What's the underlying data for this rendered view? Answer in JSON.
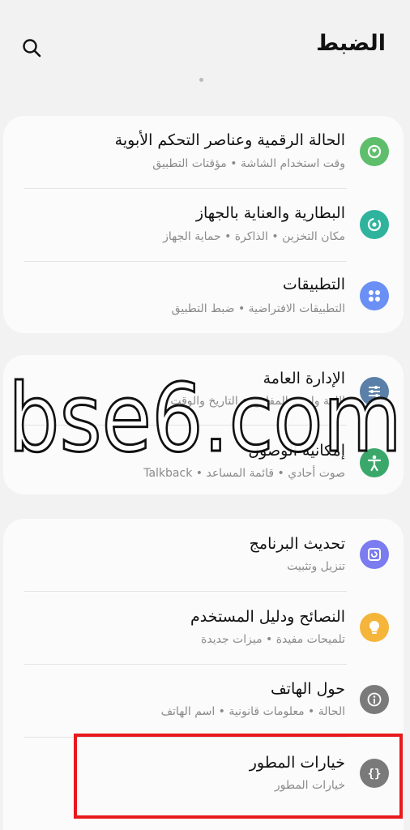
{
  "header": {
    "title": "الضبط",
    "search_icon": "search-icon"
  },
  "groups": [
    {
      "items": [
        {
          "title": "الحالة الرقمية وعناصر التحكم الأبوية",
          "subtitle": "وقت استخدام الشاشة • مؤقتات التطبيق",
          "icon": "digital-wellbeing-icon",
          "color": "#5fbe6c"
        },
        {
          "title": "البطارية والعناية بالجهاز",
          "subtitle": "مكان التخزين • الذاكرة • حماية الجهاز",
          "icon": "device-care-icon",
          "color": "#2fb39d"
        },
        {
          "title": "التطبيقات",
          "subtitle": "التطبيقات الافتراضية • ضبط التطبيق",
          "icon": "apps-icon",
          "color": "#6a8ff5"
        }
      ]
    },
    {
      "items": [
        {
          "title": "الإدارة العامة",
          "subtitle": "اللغة ولوحة المفاتيح • التاريخ والوقت",
          "icon": "sliders-icon",
          "color": "#5a7fa8"
        },
        {
          "title": "إمكانية الوصول",
          "subtitle": "صوت أحادي • قائمة المساعد • Talkback",
          "icon": "accessibility-icon",
          "color": "#3aa86a"
        }
      ]
    },
    {
      "items": [
        {
          "title": "تحديث البرنامج",
          "subtitle": "تنزيل وتثبيت",
          "icon": "software-update-icon",
          "color": "#7b7cef"
        },
        {
          "title": "النصائح ودليل المستخدم",
          "subtitle": "تلميحات مفيدة • ميزات جديدة",
          "icon": "lightbulb-icon",
          "color": "#f5b53a"
        },
        {
          "title": "حول الهاتف",
          "subtitle": "الحالة • معلومات قانونية • اسم الهاتف",
          "icon": "info-icon",
          "color": "#7a7a7a"
        },
        {
          "title": "خيارات المطور",
          "subtitle": "خيارات المطور",
          "icon": "developer-options-icon",
          "color": "#7a7a7a"
        }
      ]
    }
  ],
  "watermark": "bse6.com",
  "colors": {
    "highlight_box": "#e8191c",
    "background": "#f2f2f2",
    "card": "#fbfbfb"
  }
}
